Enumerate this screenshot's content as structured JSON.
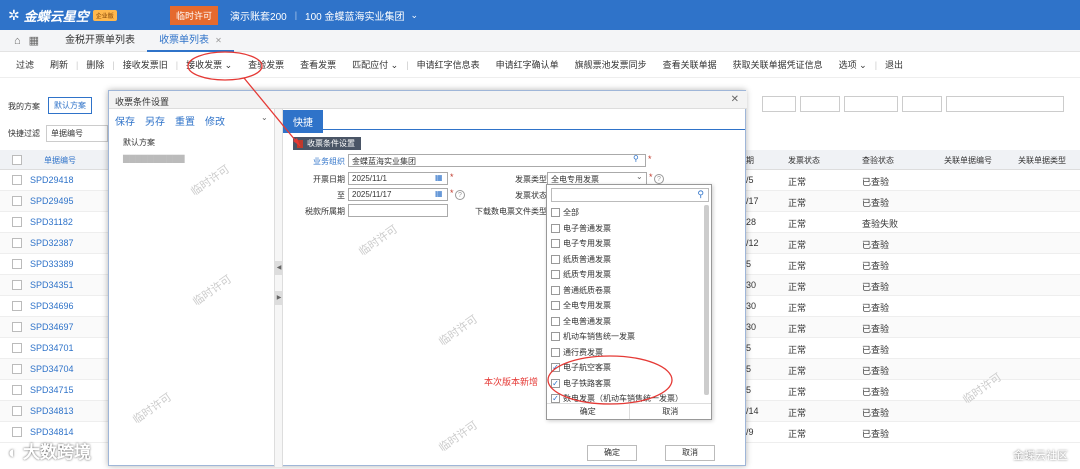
{
  "topbar": {
    "logo_text": "金蝶云星空",
    "logo_badge": "企业版",
    "temp_license": "临时许可",
    "account": "演示账套200",
    "org": "100 金蝶蓝海实业集团"
  },
  "tabs": [
    "金税开票单列表",
    "收票单列表"
  ],
  "toolbar": [
    "过滤",
    "刷新",
    "删除",
    "接收发票旧",
    "接收发票 ⌄",
    "查验发票",
    "查看发票",
    "匹配应付 ⌄",
    "申请红字信息表",
    "申请红字确认单",
    "旗舰票池发票同步",
    "查看关联单据",
    "获取关联单据凭证信息",
    "选项 ⌄",
    "退出"
  ],
  "bg": {
    "my_scheme": "我的方案",
    "default_scheme": "默认方案",
    "quick_filter": "快捷过滤",
    "filter_field": "单据编号",
    "grid_headers": [
      "单据编号",
      "期",
      "发票状态",
      "查验状态",
      "关联单据编号",
      "关联单据类型"
    ],
    "rows": [
      {
        "no": "SPD29418",
        "d": "/5",
        "status": "正常",
        "check": "已查验"
      },
      {
        "no": "SPD29495",
        "d": "/17",
        "status": "正常",
        "check": "已查验"
      },
      {
        "no": "SPD31182",
        "d": "28",
        "status": "正常",
        "check": "查验失败"
      },
      {
        "no": "SPD32387",
        "d": "/12",
        "status": "正常",
        "check": "已查验"
      },
      {
        "no": "SPD33389",
        "d": "5",
        "status": "正常",
        "check": "已查验"
      },
      {
        "no": "SPD34351",
        "d": "30",
        "status": "正常",
        "check": "已查验"
      },
      {
        "no": "SPD34696",
        "d": "30",
        "status": "正常",
        "check": "已查验"
      },
      {
        "no": "SPD34697",
        "d": "30",
        "status": "正常",
        "check": "已查验"
      },
      {
        "no": "SPD34701",
        "d": "5",
        "status": "正常",
        "check": "已查验"
      },
      {
        "no": "SPD34704",
        "d": "5",
        "status": "正常",
        "check": "已查验"
      },
      {
        "no": "SPD34715",
        "d": "5",
        "status": "正常",
        "check": "已查验"
      },
      {
        "no": "SPD34813",
        "d": "/14",
        "status": "正常",
        "check": "已查验"
      },
      {
        "no": "SPD34814",
        "d": "/9",
        "status": "正常",
        "check": "已查验"
      }
    ]
  },
  "modal": {
    "title": "收票条件设置",
    "scheme_actions": [
      "保存",
      "另存",
      "重置",
      "修改"
    ],
    "default_scheme": "默认方案",
    "quick_tab": "快捷",
    "section": "收票条件设置",
    "fields": {
      "org_label": "业务组织",
      "org_value": "金蝶蓝海实业集团",
      "date_label": "开票日期",
      "date_from": "2025/11/1",
      "to_label": "至",
      "date_to": "2025/11/17",
      "tax_period_label": "税款所属期",
      "invoice_type_label": "发票类型",
      "invoice_type_value": "全电专用发票",
      "invoice_status_label": "发票状态",
      "download_type_label": "下载数电票文件类型"
    },
    "ok": "确定",
    "cancel": "取消"
  },
  "dropdown": {
    "items": [
      {
        "label": "全部",
        "checked": false
      },
      {
        "label": "电子普通发票",
        "checked": false
      },
      {
        "label": "电子专用发票",
        "checked": false
      },
      {
        "label": "纸质普通发票",
        "checked": false
      },
      {
        "label": "纸质专用发票",
        "checked": false
      },
      {
        "label": "普通纸质卷票",
        "checked": false
      },
      {
        "label": "全电专用发票",
        "checked": false
      },
      {
        "label": "全电普通发票",
        "checked": false
      },
      {
        "label": "机动车销售统一发票",
        "checked": false
      },
      {
        "label": "通行费发票",
        "checked": false
      },
      {
        "label": "电子航空客票",
        "checked": true
      },
      {
        "label": "电子铁路客票",
        "checked": true
      },
      {
        "label": "数电发票（机动车销售统一发票）",
        "checked": true
      }
    ],
    "ok": "确定",
    "cancel": "取消"
  },
  "annotation": "本次版本新增",
  "watermark": "临时许可",
  "brand_left": "大数跨境",
  "brand_right": "金蝶云社区"
}
